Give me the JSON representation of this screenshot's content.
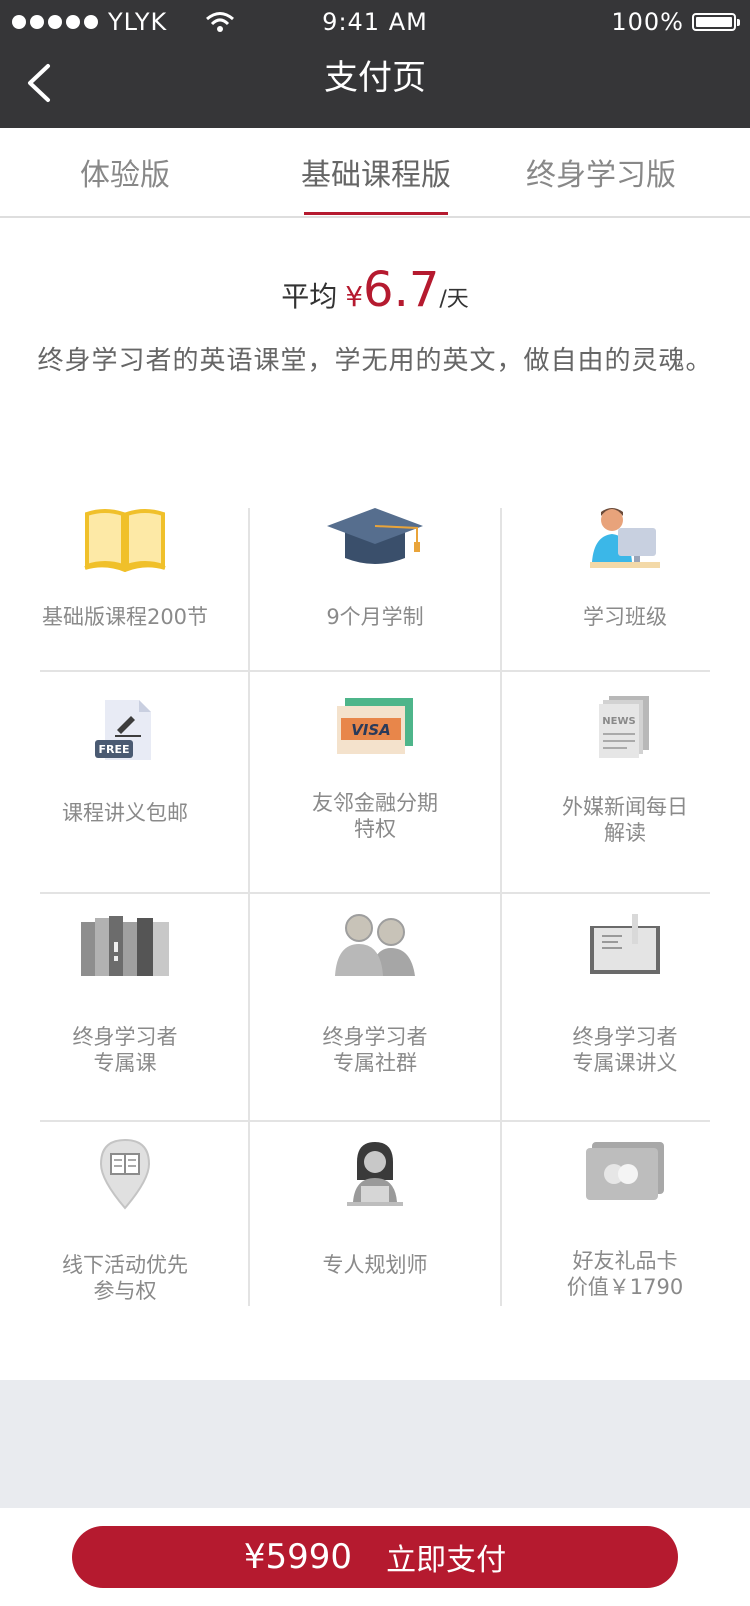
{
  "status_bar": {
    "carrier": "YLYK",
    "time": "9:41 AM",
    "battery": "100%"
  },
  "header": {
    "title": "支付页"
  },
  "tabs": [
    {
      "label": "体验版"
    },
    {
      "label": "基础课程版"
    },
    {
      "label": "终身学习版"
    }
  ],
  "active_tab": "基础课程版",
  "pricing": {
    "prefix": "平均",
    "currency": "¥",
    "amount": "6.7",
    "unit": "/天"
  },
  "slogan": "终身学习者的英语课堂，学无用的英文，做自由的灵魂。",
  "benefits": [
    {
      "line1": "基础版课程200节",
      "line2": "",
      "icon": "book-icon"
    },
    {
      "line1": "9个月学制",
      "line2": "",
      "icon": "graduation-cap-icon"
    },
    {
      "line1": "学习班级",
      "line2": "",
      "icon": "student-computer-icon"
    },
    {
      "line1": "课程讲义包邮",
      "line2": "",
      "icon": "free-document-icon"
    },
    {
      "line1": "友邻金融分期",
      "line2": "特权",
      "icon": "visa-card-icon"
    },
    {
      "line1": "外媒新闻每日",
      "line2": "解读",
      "icon": "newspaper-icon"
    },
    {
      "line1": "终身学习者",
      "line2": "专属课",
      "icon": "books-icon"
    },
    {
      "line1": "终身学习者",
      "line2": "专属社群",
      "icon": "community-icon"
    },
    {
      "line1": "终身学习者",
      "line2": "专属课讲义",
      "icon": "notebook-icon"
    },
    {
      "line1": "线下活动优先",
      "line2": "参与权",
      "icon": "location-pin-icon"
    },
    {
      "line1": "专人规划师",
      "line2": "",
      "icon": "planner-icon"
    },
    {
      "line1": "好友礼品卡",
      "line2": "价值￥1790",
      "icon": "gift-card-icon"
    }
  ],
  "pay_button": {
    "amount": "¥5990",
    "label": "立即支付"
  },
  "colors": {
    "accent": "#b51a2f",
    "header_bg": "#363638",
    "page_bg": "#e9ebef"
  }
}
